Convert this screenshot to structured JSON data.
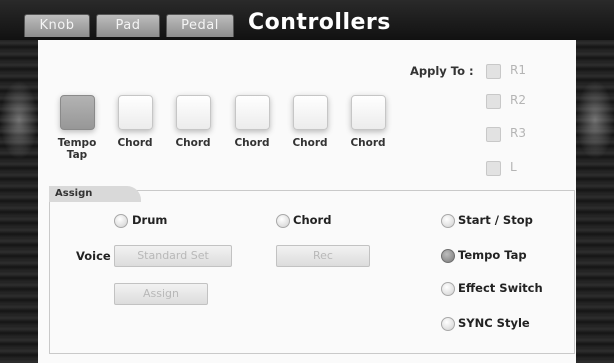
{
  "tabs": [
    "Knob",
    "Pad",
    "Pedal"
  ],
  "title": "Controllers",
  "pads": [
    {
      "label": "Tempo Tap",
      "active": true
    },
    {
      "label": "Chord",
      "active": false
    },
    {
      "label": "Chord",
      "active": false
    },
    {
      "label": "Chord",
      "active": false
    },
    {
      "label": "Chord",
      "active": false
    },
    {
      "label": "Chord",
      "active": false
    }
  ],
  "apply_to": {
    "label": "Apply To :",
    "options": [
      "R1",
      "R2",
      "R3",
      "L"
    ]
  },
  "assign": {
    "section_label": "Assign",
    "drum_label": "Drum",
    "chord_label": "Chord",
    "voice_label": "Voice",
    "voice_value": "Standard Set",
    "chord_value": "Rec",
    "assign_button": "Assign",
    "functions": [
      {
        "label": "Start / Stop",
        "selected": false
      },
      {
        "label": "Tempo Tap",
        "selected": true
      },
      {
        "label": "Effect Switch",
        "selected": false
      },
      {
        "label": "SYNC Style",
        "selected": false
      }
    ]
  }
}
